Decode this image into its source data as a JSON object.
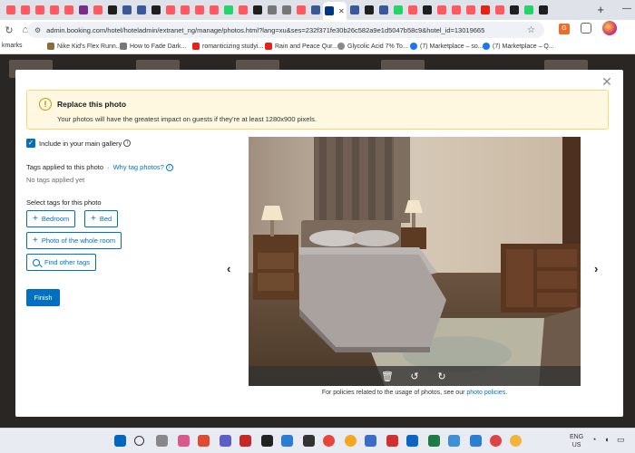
{
  "browser": {
    "url": "admin.booking.com/hotel/hoteladmin/extranet_ng/manage/photos.html?lang=xu&ses=232f371fe30b26c582a9e1d5047b58c9&hotel_id=13019665",
    "bookmarks": [
      {
        "label": "kmarks",
        "color": ""
      },
      {
        "label": "Nike Kid's Flex Runn...",
        "color": "#8a6d3b"
      },
      {
        "label": "How to Fade Dark...",
        "color": "#777777"
      },
      {
        "label": "romanticizing studyi...",
        "color": "#e62117"
      },
      {
        "label": "Rain and Peace Qur...",
        "color": "#e62117"
      },
      {
        "label": "Glycolic Acid 7% To...",
        "color": "#888888"
      },
      {
        "label": "(7) Marketplace – so...",
        "color": "#1877f2"
      },
      {
        "label": "(7) Marketplace – Q...",
        "color": "#1877f2"
      }
    ],
    "ext_badge": "G",
    "tray": {
      "lang1": "ENG",
      "lang2": "US"
    }
  },
  "modal": {
    "alert": {
      "title": "Replace this photo",
      "text": "Your photos will have the greatest impact on guests if they're at least 1280x900 pixels."
    },
    "include_label": "Include in your main gallery",
    "tags_applied_label": "Tags applied to this photo",
    "why_link": "Why tag photos?",
    "no_tags": "No tags applied yet",
    "select_tags_label": "Select tags for this photo",
    "tag_buttons": [
      "Bedroom",
      "Bed",
      "Photo of the whole room"
    ],
    "find_tags": "Find other tags",
    "finish": "Finish",
    "policy_text": "For policies related to the usage of photos, see our",
    "policy_link": "photo policies",
    "policy_end": "."
  },
  "colors": {
    "primary": "#0071c2",
    "alert_bg": "#fef8e1",
    "alert_border": "#f6d87a"
  }
}
